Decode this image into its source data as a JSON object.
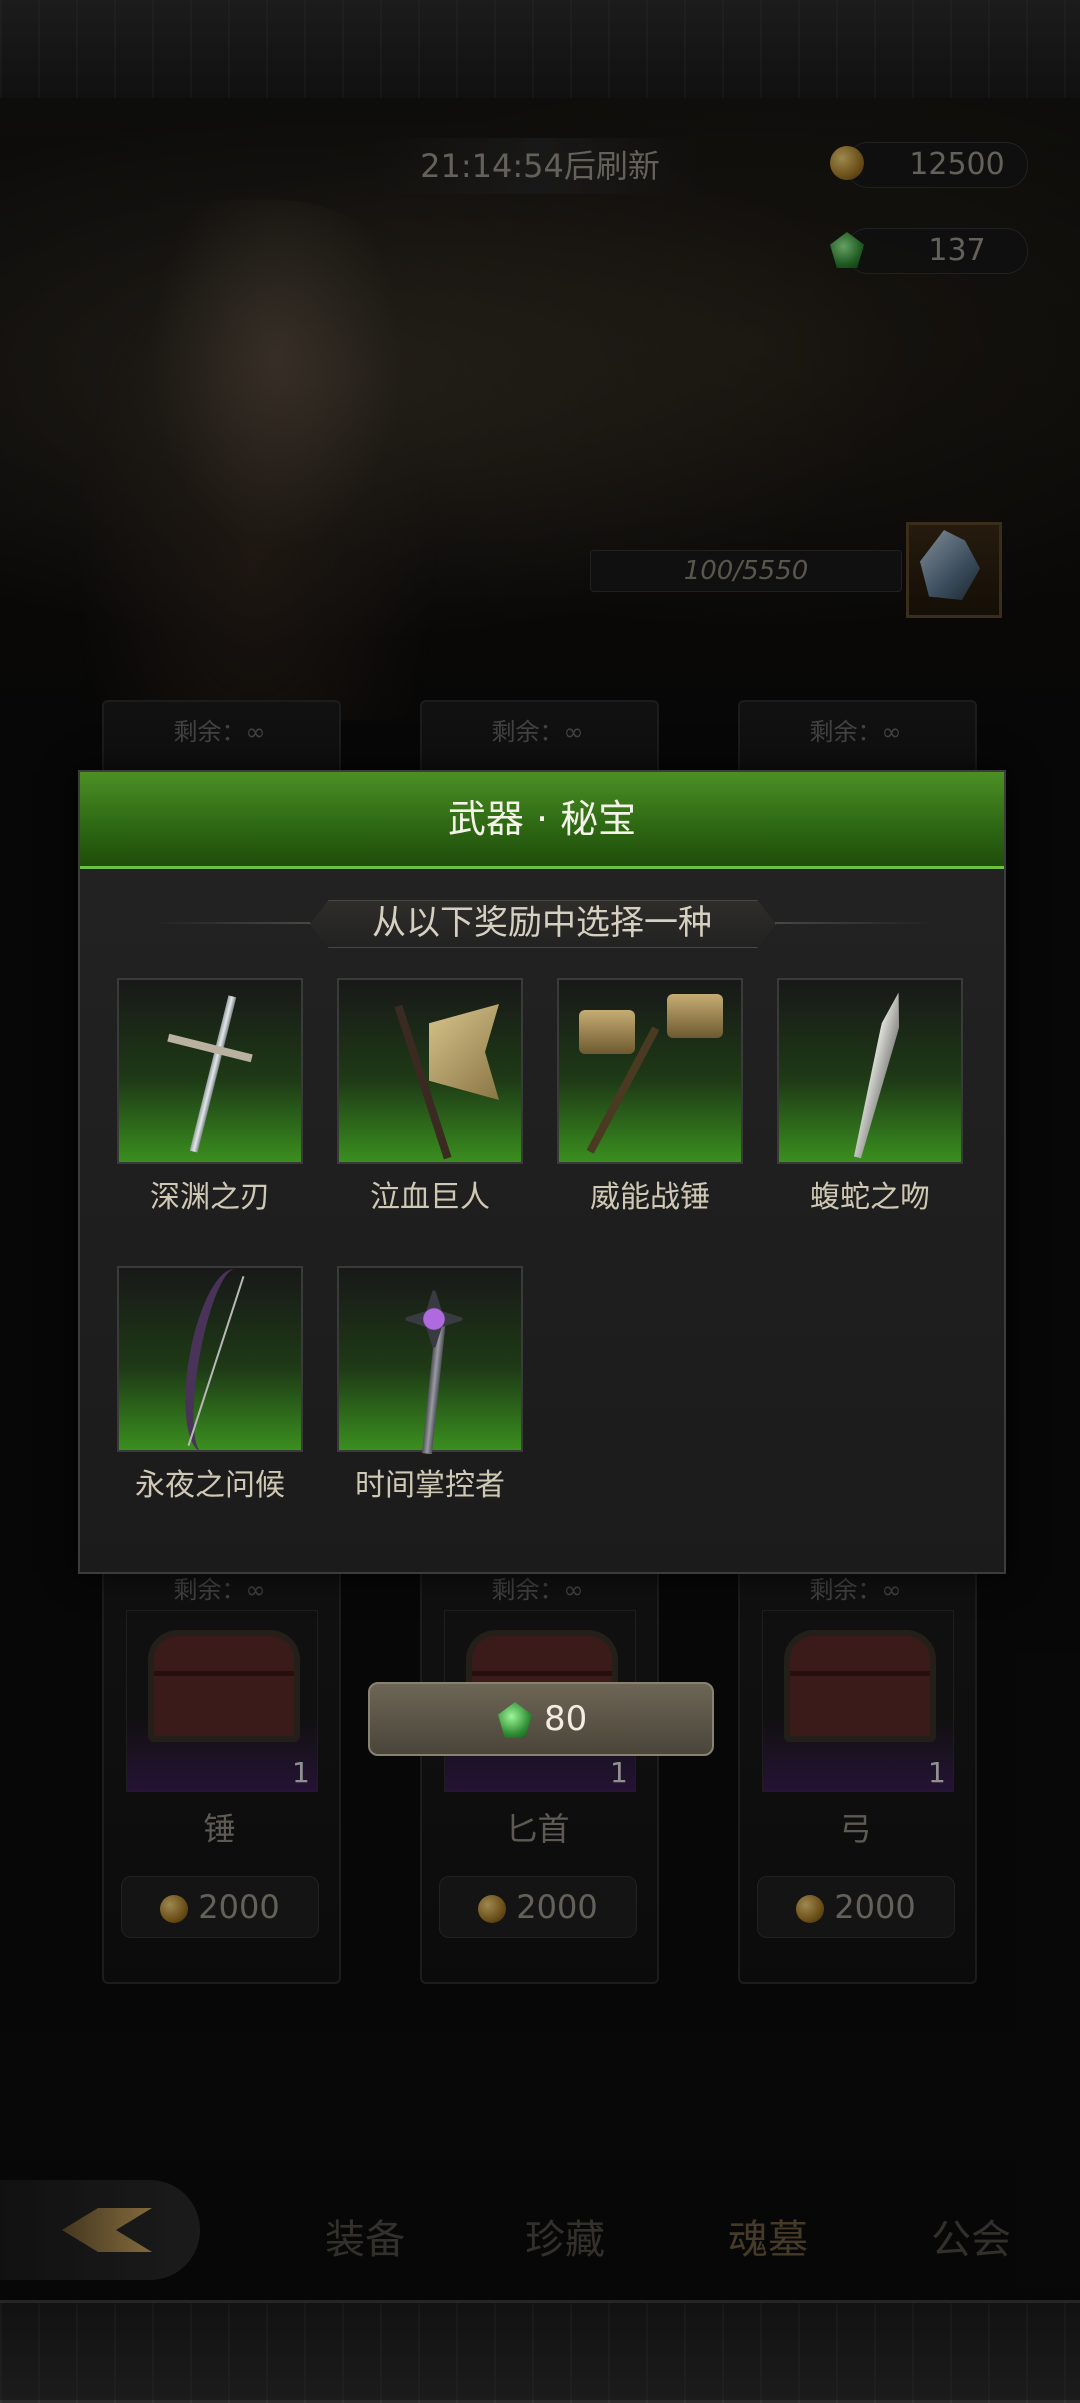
{
  "header": {
    "refresh_timer": "21:14:54后刷新",
    "currencies": [
      {
        "icon": "gold-coin-icon",
        "amount": "12500"
      },
      {
        "icon": "green-gem-icon",
        "amount": "137"
      }
    ],
    "progress_text": "100/5550"
  },
  "shop": {
    "top_remaining": [
      "剩余：∞",
      "剩余：∞",
      "剩余：∞"
    ],
    "items": [
      {
        "remaining": "剩余：∞",
        "quantity": "1",
        "name": "锤",
        "price": "2000"
      },
      {
        "remaining": "剩余：∞",
        "quantity": "1",
        "name": "匕首",
        "price": "2000"
      },
      {
        "remaining": "剩余：∞",
        "quantity": "1",
        "name": "弓",
        "price": "2000"
      }
    ],
    "gem_cost": "80"
  },
  "dialog": {
    "title": "武器 · 秘宝",
    "subtitle": "从以下奖励中选择一种",
    "rewards": [
      {
        "name": "深渊之刃",
        "icon": "greatsword-icon"
      },
      {
        "name": "泣血巨人",
        "icon": "battle-axe-icon"
      },
      {
        "name": "威能战锤",
        "icon": "war-hammer-icon"
      },
      {
        "name": "蝮蛇之吻",
        "icon": "curved-dagger-icon"
      },
      {
        "name": "永夜之问候",
        "icon": "bow-icon"
      },
      {
        "name": "时间掌控者",
        "icon": "scepter-icon"
      }
    ]
  },
  "nav": {
    "items": [
      "装备",
      "珍藏",
      "魂墓",
      "公会"
    ],
    "active": "魂墓"
  },
  "colors": {
    "header_green": "#3f7f1f",
    "reward_glow": "#3a8f1f",
    "rarity_purple": "#3a1d52"
  }
}
